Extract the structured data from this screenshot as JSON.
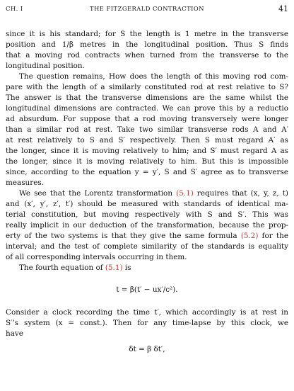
{
  "header": {
    "chapter": "CH. I",
    "title": "THE FITZGERALD CONTRACTION",
    "page_number": "41"
  },
  "body": {
    "p1": [
      "since it is his standard; for S the length is 1 metre in the transverse",
      "position and 1/β metres in the longitudinal position.  Thus S finds",
      "that a moving rod contracts when turned from the transverse to the",
      "longitudinal position."
    ],
    "p2": [
      "The question remains, How does the length of this moving rod com-",
      "pare with the length of a similarly constituted rod at rest relative to S?",
      "The answer is that the transverse dimensions are the same whilst the",
      "longitudinal dimensions are contracted. We can prove this by a reductio",
      "ad absurdum. For suppose that a rod moving transversely were longer",
      "than a similar rod at rest. Take two similar transverse rods A and A′",
      "at rest relatively to S and S′ respectively. Then S must regard A′ as",
      "the longer, since it is moving relatively to him; and S′ must regard A as",
      "the longer, since it is moving relatively to him. But this is impossible",
      "since, according to the equation y = y′, S and S′ agree as to transverse",
      "measures."
    ],
    "p3": [
      "We see that the Lorentz transformation (5.1) requires that (x, y, z, t)",
      "and (x′, y′, z′, t′) should be measured with standards of identical ma-",
      "terial constitution, but moving respectively with S and S′.  This was",
      "really implicit in our deduction of the transformation, because the prop-",
      "erty of the two systems is that they give the same formula (5.2) for the",
      "interval; and the test of complete similarity of the standards is equality",
      "of all corresponding intervals occurring in them."
    ],
    "p4": "The fourth equation of (5.1) is",
    "eq1": "t = β(t′ − ux′/c²).",
    "p5": [
      "Consider a clock recording the time t′, which accordingly is at rest in",
      "S′’s system (x = const.).  Then for any time-lapse by this clock, we",
      "have"
    ],
    "eq2": "δt = β δt′,"
  }
}
